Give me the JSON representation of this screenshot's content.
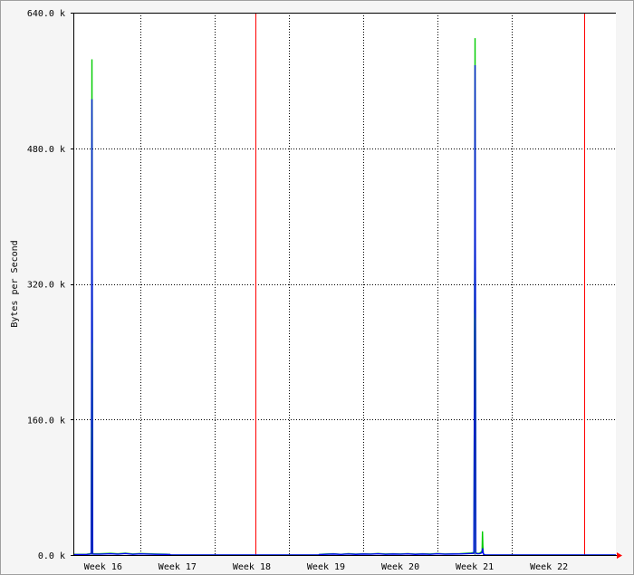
{
  "chart_data": {
    "type": "line",
    "ylabel": "Bytes per Second",
    "ylim": [
      0,
      640000
    ],
    "y_ticks": [
      {
        "value": 0,
        "label": "0.0 k"
      },
      {
        "value": 160000,
        "label": "160.0 k"
      },
      {
        "value": 320000,
        "label": "320.0 k"
      },
      {
        "value": 480000,
        "label": "480.0 k"
      },
      {
        "value": 640000,
        "label": "640.0 k"
      }
    ],
    "xlim": [
      15.6,
      22.9
    ],
    "x_ticks": [
      {
        "value": 16,
        "label": "Week 16"
      },
      {
        "value": 17,
        "label": "Week 17"
      },
      {
        "value": 18,
        "label": "Week 18"
      },
      {
        "value": 19,
        "label": "Week 19"
      },
      {
        "value": 20,
        "label": "Week 20"
      },
      {
        "value": 21,
        "label": "Week 21"
      },
      {
        "value": 22,
        "label": "Week 22"
      }
    ],
    "x_grid": [
      16.5,
      17.5,
      18.5,
      19.5,
      20.5,
      21.5
    ],
    "month_markers": [
      18.05,
      22.47
    ],
    "grid": true,
    "colors": {
      "background": "#f5f5f5",
      "plot_background": "#ffffff",
      "grid": "#000000",
      "month_marker": "#ff0000",
      "in_series": "#00cc00",
      "out_series": "#0000ff",
      "overlap": "#006060",
      "arrow": "#ff0000"
    },
    "series": [
      {
        "x": [
          15.6,
          15.78,
          15.82,
          15.84,
          15.845,
          15.85,
          15.855,
          15.86,
          15.87,
          15.95,
          16.1,
          16.2,
          16.3,
          16.4,
          16.5,
          16.6,
          16.7,
          16.85,
          16.9,
          16.91,
          18.9,
          18.91,
          19.0,
          19.1,
          19.2,
          19.3,
          19.4,
          19.5,
          19.6,
          19.7,
          19.8,
          19.9,
          20.0,
          20.1,
          20.2,
          20.3,
          20.4,
          20.5,
          20.6,
          20.7,
          20.8,
          20.95,
          20.99,
          21.0,
          21.005,
          21.01,
          21.015,
          21.02,
          21.03,
          21.06,
          21.08,
          21.1,
          21.105,
          21.11,
          21.115,
          21.12,
          21.13,
          21.14,
          22.9
        ],
        "y": [
          800,
          1000,
          1500,
          2000,
          200000,
          585000,
          300000,
          2000,
          1500,
          1500,
          2000,
          1500,
          2200,
          1200,
          1800,
          1500,
          1200,
          1000,
          800,
          0,
          0,
          800,
          1200,
          1500,
          900,
          1600,
          1100,
          1500,
          1300,
          1800,
          1200,
          1500,
          1300,
          1700,
          1100,
          1500,
          1200,
          1800,
          1300,
          1500,
          1600,
          2500,
          3000,
          350000,
          610000,
          300000,
          3000,
          2500,
          2000,
          2000,
          3000,
          5000,
          28000,
          12000,
          3000,
          1000,
          800,
          0,
          0
        ]
      },
      {
        "x": [
          15.6,
          15.78,
          15.82,
          15.84,
          15.845,
          15.85,
          15.855,
          15.86,
          15.87,
          15.95,
          16.1,
          16.2,
          16.3,
          16.4,
          16.5,
          16.6,
          16.7,
          16.85,
          16.9,
          16.91,
          18.9,
          18.91,
          19.0,
          19.1,
          19.2,
          19.3,
          19.4,
          19.5,
          19.6,
          19.7,
          19.8,
          19.9,
          20.0,
          20.1,
          20.2,
          20.3,
          20.4,
          20.5,
          20.6,
          20.7,
          20.8,
          20.95,
          20.99,
          21.0,
          21.005,
          21.01,
          21.015,
          21.02,
          21.03,
          21.06,
          21.08,
          21.1,
          21.105,
          21.11,
          21.115,
          21.12,
          21.13,
          21.14,
          22.9
        ],
        "y": [
          500,
          700,
          1000,
          1500,
          150000,
          538000,
          250000,
          1500,
          1000,
          1000,
          1500,
          1000,
          1800,
          900,
          1400,
          1100,
          900,
          700,
          600,
          0,
          0,
          600,
          900,
          1200,
          700,
          1300,
          800,
          1200,
          1000,
          1500,
          900,
          1200,
          1000,
          1400,
          800,
          1200,
          900,
          1500,
          1000,
          1200,
          1300,
          1800,
          2000,
          285000,
          578000,
          280000,
          2500,
          2000,
          1500,
          1500,
          2000,
          3000,
          8000,
          5000,
          2000,
          800,
          600,
          0,
          0
        ]
      }
    ]
  }
}
